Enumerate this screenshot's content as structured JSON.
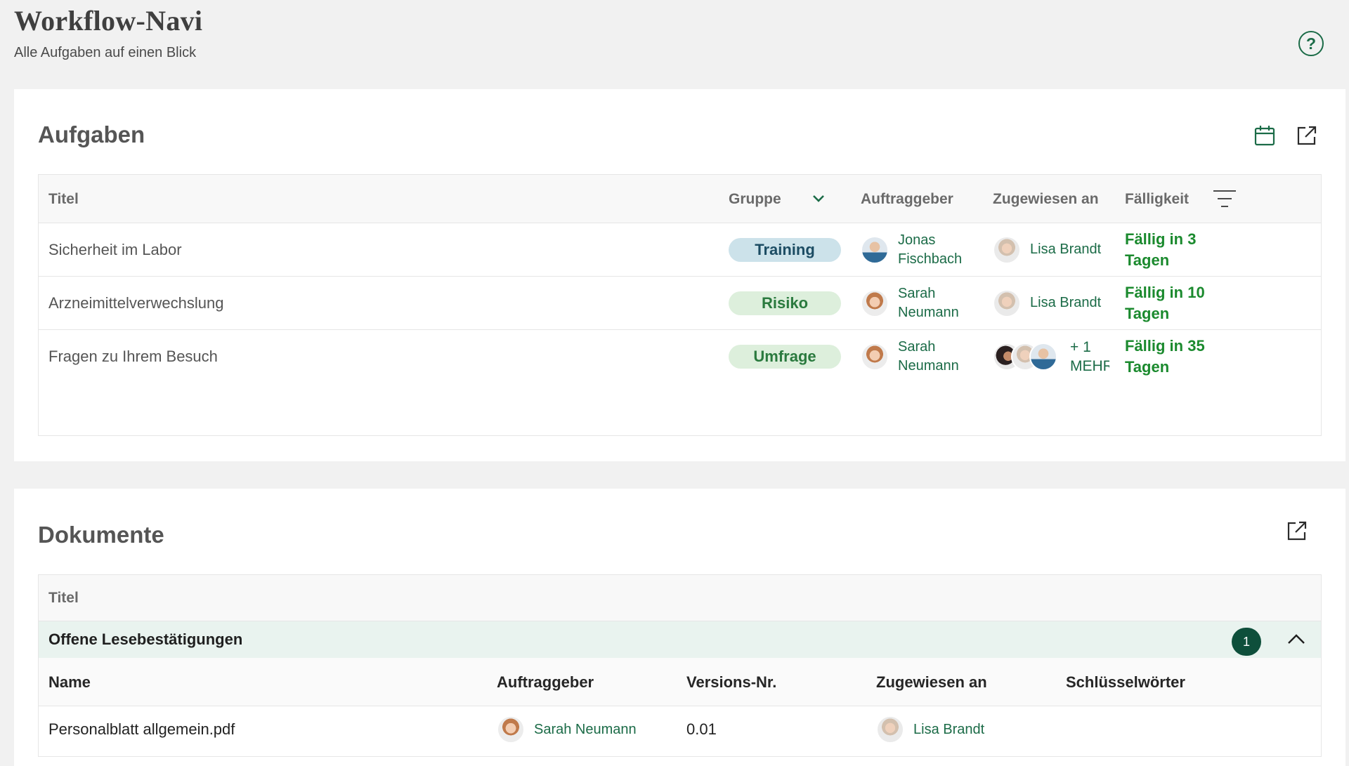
{
  "header": {
    "title": "Workflow-Navi",
    "subtitle": "Alle Aufgaben auf einen Blick",
    "help_icon": "question-circle-icon"
  },
  "colors": {
    "accent": "#1b6b47",
    "due_green": "#1b8a2e",
    "badge_bg": "#0e4f3b",
    "group_row_bg": "#e9f3ef"
  },
  "tasks": {
    "title": "Aufgaben",
    "actions": [
      "calendar-icon",
      "external-link-icon"
    ],
    "columns": {
      "title": "Titel",
      "group": "Gruppe",
      "requester": "Auftraggeber",
      "assigned": "Zugewiesen an",
      "due": "Fälligkeit"
    },
    "rows": [
      {
        "title": "Sicherheit im Labor",
        "group": "Training",
        "requester_line1": "Jonas",
        "requester_line2": "Fischbach",
        "assigned": "Lisa Brandt",
        "due_line1": "Fällig in 3",
        "due_line2": "Tagen"
      },
      {
        "title": "Arzneimittelverwechslung",
        "group": "Risiko",
        "requester_line1": "Sarah",
        "requester_line2": "Neumann",
        "assigned": "Lisa Brandt",
        "due_line1": "Fällig in 10",
        "due_line2": "Tagen"
      },
      {
        "title": "Fragen zu Ihrem Besuch",
        "group": "Umfrage",
        "requester_line1": "Sarah",
        "requester_line2": "Neumann",
        "assigned_more_line1": "+ 1",
        "assigned_more_line2": "MEHR",
        "due_line1": "Fällig in 35",
        "due_line2": "Tagen"
      }
    ]
  },
  "documents": {
    "title": "Dokumente",
    "header_col": "Titel",
    "group": {
      "title": "Offene Lesebestätigungen",
      "count": "1"
    },
    "columns": {
      "name": "Name",
      "requester": "Auftraggeber",
      "version": "Versions-Nr.",
      "assigned": "Zugewiesen an",
      "keywords": "Schlüsselwörter"
    },
    "rows": [
      {
        "name": "Personalblatt allgemein.pdf",
        "requester": "Sarah Neumann",
        "version": "0.01",
        "assigned": "Lisa Brandt",
        "keywords": ""
      }
    ]
  }
}
